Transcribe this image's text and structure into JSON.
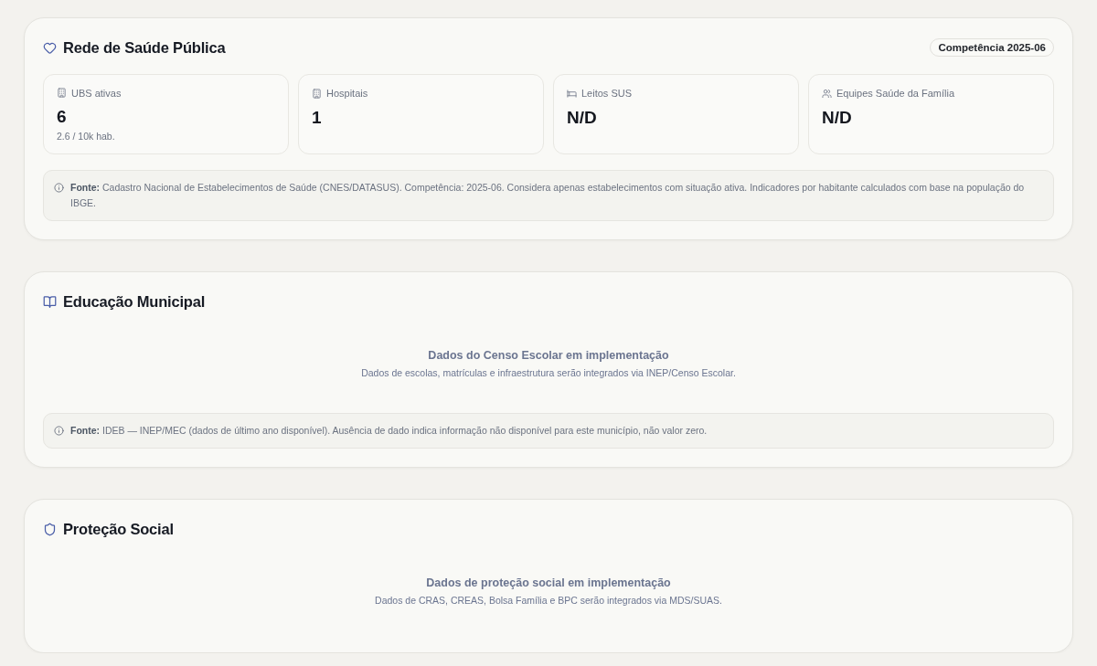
{
  "sections": [
    {
      "kind": "stats",
      "title": "Rede de Saúde Pública",
      "badge": "Competência 2025-06",
      "stats": [
        {
          "label": "UBS ativas",
          "value": "6",
          "note": "2.6 / 10k hab."
        },
        {
          "label": "Hospitais",
          "value": "1"
        },
        {
          "label": "Leitos SUS",
          "value": "N/D"
        },
        {
          "label": "Equipes Saúde da Família",
          "value": "N/D"
        }
      ],
      "source": "**Fonte:** Cadastro Nacional de Estabelecimentos de Saúde (CNES/DATASUS). Competência: 2025-06. Considera apenas estabelecimentos com situação ativa. Indicadores por habitante calculados com base na população do IBGE."
    },
    {
      "kind": "placeholder",
      "title": "Educação Municipal",
      "empty_title": "Dados do Censo Escolar em implementação",
      "empty_text": "Dados de escolas, matrículas e infraestrutura serão integrados via INEP/Censo Escolar.",
      "source": "**Fonte:** IDEB — INEP/MEC (dados de último ano disponível). Ausência de dado indica informação não disponível para este município, não valor zero."
    },
    {
      "kind": "placeholder",
      "title": "Proteção Social",
      "empty_title": "Dados de proteção social em implementação",
      "empty_text": "Dados de CRAS, CREAS, Bolsa Família e BPC serão integrados via MDS/SUAS."
    }
  ]
}
